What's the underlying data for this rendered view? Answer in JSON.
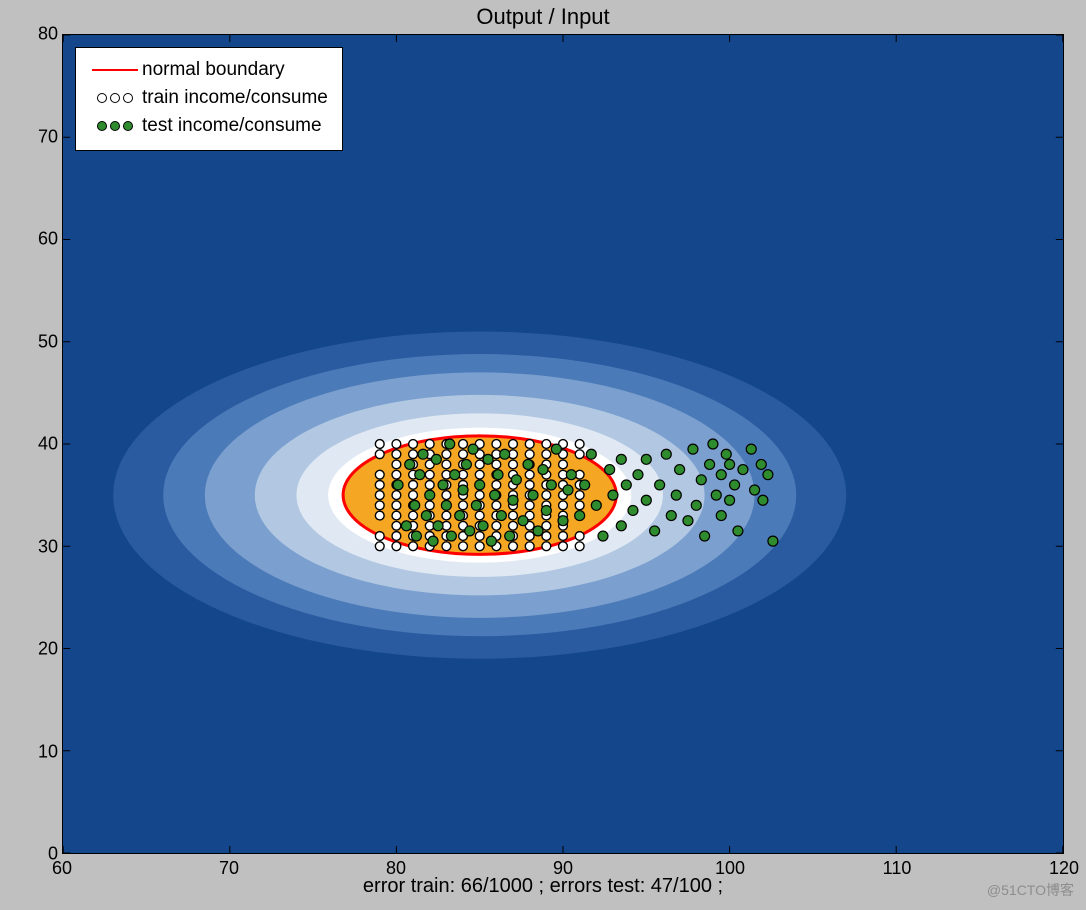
{
  "chart_data": {
    "type": "scatter",
    "title": "Output / Input",
    "xlabel": "error train: 66/1000 ; errors test: 47/100 ;",
    "ylabel": "",
    "xlim": [
      60,
      120
    ],
    "ylim": [
      0,
      80
    ],
    "xticks": [
      60,
      70,
      80,
      90,
      100,
      110,
      120
    ],
    "yticks": [
      0,
      10,
      20,
      30,
      40,
      50,
      60,
      70,
      80
    ],
    "legend": {
      "position": "upper-left",
      "entries": [
        {
          "marker": "red-line",
          "label": "normal boundary"
        },
        {
          "marker": "open-circles",
          "label": "train income/consume"
        },
        {
          "marker": "green-circles",
          "label": "test income/consume"
        }
      ]
    },
    "contour": {
      "center": [
        85,
        35
      ],
      "rx_levels": [
        22,
        19,
        16.5,
        13.5,
        11,
        9.1
      ],
      "ry_levels": [
        16,
        13.8,
        12,
        9.8,
        8.0,
        6.6
      ],
      "colors": [
        "#2a5ba0",
        "#4b7ab8",
        "#7ba0cf",
        "#b2c8e2",
        "#e0e9f3",
        "#ffffff"
      ]
    },
    "boundary_ellipse": {
      "cx": 85,
      "cy": 35,
      "rx": 8.2,
      "ry": 5.8,
      "fill": "#f5a623",
      "stroke": "#ff0000"
    },
    "series": [
      {
        "name": "train income/consume",
        "marker": "open-circle",
        "points": [
          [
            79.0,
            30
          ],
          [
            79.0,
            31
          ],
          [
            79.0,
            33
          ],
          [
            79.0,
            34
          ],
          [
            79.0,
            35
          ],
          [
            79.0,
            36
          ],
          [
            79.0,
            37
          ],
          [
            79.0,
            39
          ],
          [
            79.0,
            40
          ],
          [
            80.0,
            30
          ],
          [
            80.0,
            31
          ],
          [
            80.0,
            32
          ],
          [
            80.0,
            33
          ],
          [
            80.0,
            34
          ],
          [
            80.0,
            35
          ],
          [
            80.0,
            36
          ],
          [
            80.0,
            37
          ],
          [
            80.0,
            38
          ],
          [
            80.0,
            39
          ],
          [
            80.0,
            40
          ],
          [
            81.0,
            30
          ],
          [
            81.0,
            31
          ],
          [
            81.0,
            32
          ],
          [
            81.0,
            33
          ],
          [
            81.0,
            34
          ],
          [
            81.0,
            35
          ],
          [
            81.0,
            36
          ],
          [
            81.0,
            37
          ],
          [
            81.0,
            38
          ],
          [
            81.0,
            39
          ],
          [
            81.0,
            40
          ],
          [
            82.0,
            30
          ],
          [
            82.0,
            31
          ],
          [
            82.0,
            32
          ],
          [
            82.0,
            33
          ],
          [
            82.0,
            34
          ],
          [
            82.0,
            35
          ],
          [
            82.0,
            36
          ],
          [
            82.0,
            37
          ],
          [
            82.0,
            38
          ],
          [
            82.0,
            39
          ],
          [
            82.0,
            40
          ],
          [
            83.0,
            30
          ],
          [
            83.0,
            31
          ],
          [
            83.0,
            32
          ],
          [
            83.0,
            33
          ],
          [
            83.0,
            34
          ],
          [
            83.0,
            35
          ],
          [
            83.0,
            36
          ],
          [
            83.0,
            37
          ],
          [
            83.0,
            38
          ],
          [
            83.0,
            39
          ],
          [
            83.0,
            40
          ],
          [
            84.0,
            30
          ],
          [
            84.0,
            31
          ],
          [
            84.0,
            32
          ],
          [
            84.0,
            33
          ],
          [
            84.0,
            34
          ],
          [
            84.0,
            35
          ],
          [
            84.0,
            36
          ],
          [
            84.0,
            37
          ],
          [
            84.0,
            38
          ],
          [
            84.0,
            39
          ],
          [
            84.0,
            40
          ],
          [
            85.0,
            30
          ],
          [
            85.0,
            31
          ],
          [
            85.0,
            32
          ],
          [
            85.0,
            33
          ],
          [
            85.0,
            34
          ],
          [
            85.0,
            35
          ],
          [
            85.0,
            36
          ],
          [
            85.0,
            37
          ],
          [
            85.0,
            38
          ],
          [
            85.0,
            39
          ],
          [
            85.0,
            40
          ],
          [
            86.0,
            30
          ],
          [
            86.0,
            31
          ],
          [
            86.0,
            32
          ],
          [
            86.0,
            33
          ],
          [
            86.0,
            34
          ],
          [
            86.0,
            35
          ],
          [
            86.0,
            36
          ],
          [
            86.0,
            37
          ],
          [
            86.0,
            38
          ],
          [
            86.0,
            39
          ],
          [
            86.0,
            40
          ],
          [
            87.0,
            30
          ],
          [
            87.0,
            31
          ],
          [
            87.0,
            32
          ],
          [
            87.0,
            33
          ],
          [
            87.0,
            34
          ],
          [
            87.0,
            35
          ],
          [
            87.0,
            36
          ],
          [
            87.0,
            37
          ],
          [
            87.0,
            38
          ],
          [
            87.0,
            39
          ],
          [
            87.0,
            40
          ],
          [
            88.0,
            30
          ],
          [
            88.0,
            31
          ],
          [
            88.0,
            32
          ],
          [
            88.0,
            33
          ],
          [
            88.0,
            34
          ],
          [
            88.0,
            35
          ],
          [
            88.0,
            36
          ],
          [
            88.0,
            37
          ],
          [
            88.0,
            38
          ],
          [
            88.0,
            39
          ],
          [
            88.0,
            40
          ],
          [
            89.0,
            30
          ],
          [
            89.0,
            31
          ],
          [
            89.0,
            32
          ],
          [
            89.0,
            33
          ],
          [
            89.0,
            34
          ],
          [
            89.0,
            35
          ],
          [
            89.0,
            36
          ],
          [
            89.0,
            37
          ],
          [
            89.0,
            38
          ],
          [
            89.0,
            39
          ],
          [
            89.0,
            40
          ],
          [
            90.0,
            30
          ],
          [
            90.0,
            31
          ],
          [
            90.0,
            32
          ],
          [
            90.0,
            33
          ],
          [
            90.0,
            34
          ],
          [
            90.0,
            35
          ],
          [
            90.0,
            36
          ],
          [
            90.0,
            37
          ],
          [
            90.0,
            38
          ],
          [
            90.0,
            39
          ],
          [
            90.0,
            40
          ],
          [
            91.0,
            30
          ],
          [
            91.0,
            31
          ],
          [
            91.0,
            33
          ],
          [
            91.0,
            34
          ],
          [
            91.0,
            35
          ],
          [
            91.0,
            36
          ],
          [
            91.0,
            37
          ],
          [
            91.0,
            39
          ],
          [
            91.0,
            40
          ]
        ]
      },
      {
        "name": "test income/consume",
        "marker": "green-circle",
        "points": [
          [
            80.1,
            36
          ],
          [
            80.6,
            32
          ],
          [
            80.8,
            38
          ],
          [
            81.1,
            34
          ],
          [
            81.2,
            31
          ],
          [
            81.4,
            37
          ],
          [
            81.6,
            39
          ],
          [
            81.8,
            33
          ],
          [
            82.0,
            35
          ],
          [
            82.2,
            30.5
          ],
          [
            82.4,
            38.5
          ],
          [
            82.5,
            32
          ],
          [
            82.8,
            36
          ],
          [
            83.0,
            34
          ],
          [
            83.2,
            40
          ],
          [
            83.3,
            31
          ],
          [
            83.5,
            37
          ],
          [
            83.8,
            33
          ],
          [
            84.0,
            35.5
          ],
          [
            84.2,
            38
          ],
          [
            84.4,
            31.5
          ],
          [
            84.6,
            39.5
          ],
          [
            84.8,
            34
          ],
          [
            85.0,
            36
          ],
          [
            85.2,
            32
          ],
          [
            85.5,
            38.5
          ],
          [
            85.7,
            30.5
          ],
          [
            85.9,
            35
          ],
          [
            86.1,
            37
          ],
          [
            86.3,
            33
          ],
          [
            86.5,
            39
          ],
          [
            86.8,
            31
          ],
          [
            87.0,
            34.5
          ],
          [
            87.2,
            36.5
          ],
          [
            87.6,
            32.5
          ],
          [
            87.9,
            38
          ],
          [
            88.2,
            35
          ],
          [
            88.5,
            31.5
          ],
          [
            88.8,
            37.5
          ],
          [
            89.0,
            33.5
          ],
          [
            89.3,
            36
          ],
          [
            89.6,
            39.5
          ],
          [
            90.0,
            32.5
          ],
          [
            90.3,
            35.5
          ],
          [
            90.5,
            37
          ],
          [
            91.0,
            33
          ],
          [
            91.3,
            36
          ],
          [
            91.7,
            39
          ],
          [
            92.0,
            34
          ],
          [
            92.4,
            31
          ],
          [
            92.8,
            37.5
          ],
          [
            93.0,
            35
          ],
          [
            93.5,
            32
          ],
          [
            93.5,
            38.5
          ],
          [
            93.8,
            36
          ],
          [
            94.2,
            33.5
          ],
          [
            94.5,
            37
          ],
          [
            95.0,
            38.5
          ],
          [
            95.0,
            34.5
          ],
          [
            95.5,
            31.5
          ],
          [
            95.8,
            36
          ],
          [
            96.2,
            39
          ],
          [
            96.5,
            33
          ],
          [
            96.8,
            35
          ],
          [
            97.0,
            37.5
          ],
          [
            97.5,
            32.5
          ],
          [
            97.8,
            39.5
          ],
          [
            98.0,
            34
          ],
          [
            98.3,
            36.5
          ],
          [
            98.5,
            31
          ],
          [
            98.8,
            38
          ],
          [
            99.0,
            40
          ],
          [
            99.2,
            35
          ],
          [
            99.5,
            33
          ],
          [
            99.5,
            37
          ],
          [
            99.8,
            39
          ],
          [
            100.0,
            34.5
          ],
          [
            100.0,
            38
          ],
          [
            100.3,
            36
          ],
          [
            100.5,
            31.5
          ],
          [
            100.8,
            37.5
          ],
          [
            101.3,
            39.5
          ],
          [
            101.5,
            35.5
          ],
          [
            101.9,
            38
          ],
          [
            102.0,
            34.5
          ],
          [
            102.3,
            37
          ],
          [
            102.6,
            30.5
          ]
        ]
      }
    ]
  },
  "watermark": "@51CTO博客"
}
